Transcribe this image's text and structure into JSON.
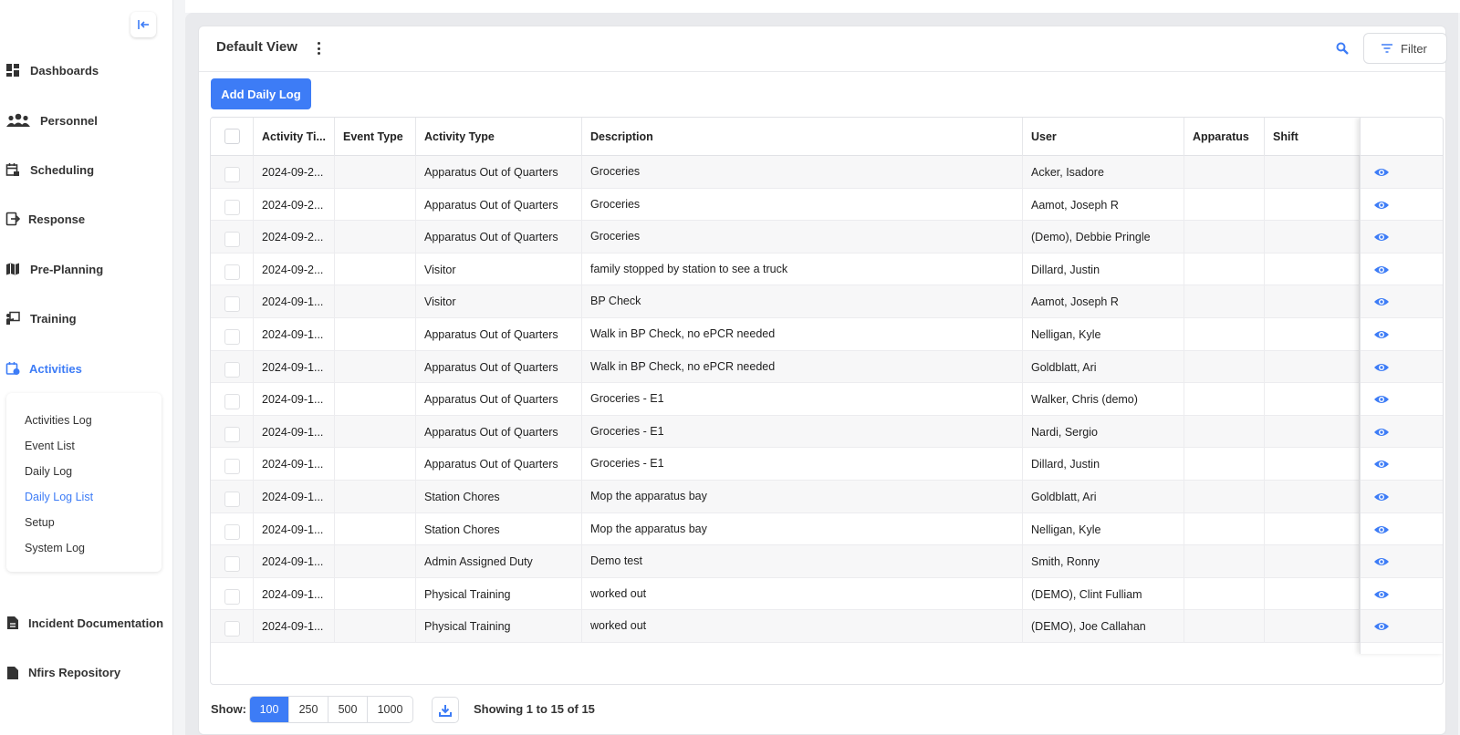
{
  "sidebar": {
    "nav": [
      {
        "label": "Dashboards",
        "icon": "grid-icon"
      },
      {
        "label": "Personnel",
        "icon": "people-icon"
      },
      {
        "label": "Scheduling",
        "icon": "calendar-icon"
      },
      {
        "label": "Response",
        "icon": "response-icon"
      },
      {
        "label": "Pre-Planning",
        "icon": "map-icon"
      },
      {
        "label": "Training",
        "icon": "training-icon"
      },
      {
        "label": "Activities",
        "icon": "activities-icon"
      },
      {
        "label": "Incident Documentation",
        "icon": "document-icon"
      },
      {
        "label": "Nfirs Repository",
        "icon": "document-icon"
      }
    ],
    "submenu": [
      "Activities Log",
      "Event List",
      "Daily Log",
      "Daily Log List",
      "Setup",
      "System Log"
    ],
    "active_nav": "Activities",
    "active_sub": "Daily Log List"
  },
  "header": {
    "title": "Default View",
    "filter_label": "Filter",
    "add_label": "Add Daily Log"
  },
  "table": {
    "columns": [
      "Activity Ti...",
      "Event Type",
      "Activity Type",
      "Description",
      "User",
      "Apparatus",
      "Shift"
    ],
    "rows": [
      {
        "time": "2024-09-2...",
        "event": "",
        "type": "Apparatus Out of Quarters",
        "desc": "Groceries",
        "user": "Acker, Isadore",
        "apparatus": "",
        "shift": ""
      },
      {
        "time": "2024-09-2...",
        "event": "",
        "type": "Apparatus Out of Quarters",
        "desc": "Groceries",
        "user": "Aamot, Joseph R",
        "apparatus": "",
        "shift": ""
      },
      {
        "time": "2024-09-2...",
        "event": "",
        "type": "Apparatus Out of Quarters",
        "desc": "Groceries",
        "user": "(Demo), Debbie Pringle",
        "apparatus": "",
        "shift": ""
      },
      {
        "time": "2024-09-2...",
        "event": "",
        "type": "Visitor",
        "desc": "family stopped by station to see a truck",
        "user": "Dillard, Justin",
        "apparatus": "",
        "shift": ""
      },
      {
        "time": "2024-09-1...",
        "event": "",
        "type": "Visitor",
        "desc": "BP Check",
        "user": "Aamot, Joseph R",
        "apparatus": "",
        "shift": ""
      },
      {
        "time": "2024-09-1...",
        "event": "",
        "type": "Apparatus Out of Quarters",
        "desc": "Walk in BP Check, no ePCR needed",
        "user": "Nelligan, Kyle",
        "apparatus": "",
        "shift": ""
      },
      {
        "time": "2024-09-1...",
        "event": "",
        "type": "Apparatus Out of Quarters",
        "desc": "Walk in BP Check, no ePCR needed",
        "user": "Goldblatt, Ari",
        "apparatus": "",
        "shift": ""
      },
      {
        "time": "2024-09-1...",
        "event": "",
        "type": "Apparatus Out of Quarters",
        "desc": "Groceries - E1",
        "user": "Walker, Chris (demo)",
        "apparatus": "",
        "shift": ""
      },
      {
        "time": "2024-09-1...",
        "event": "",
        "type": "Apparatus Out of Quarters",
        "desc": "Groceries - E1",
        "user": "Nardi, Sergio",
        "apparatus": "",
        "shift": ""
      },
      {
        "time": "2024-09-1...",
        "event": "",
        "type": "Apparatus Out of Quarters",
        "desc": "Groceries - E1",
        "user": "Dillard, Justin",
        "apparatus": "",
        "shift": ""
      },
      {
        "time": "2024-09-1...",
        "event": "",
        "type": "Station Chores",
        "desc": "Mop the apparatus bay",
        "user": "Goldblatt, Ari",
        "apparatus": "",
        "shift": ""
      },
      {
        "time": "2024-09-1...",
        "event": "",
        "type": "Station Chores",
        "desc": "Mop the apparatus bay",
        "user": "Nelligan, Kyle",
        "apparatus": "",
        "shift": ""
      },
      {
        "time": "2024-09-1...",
        "event": "",
        "type": "Admin Assigned Duty",
        "desc": "Demo test",
        "user": "Smith, Ronny",
        "apparatus": "",
        "shift": ""
      },
      {
        "time": "2024-09-1...",
        "event": "",
        "type": "Physical Training",
        "desc": "worked out",
        "user": "(DEMO), Clint Fulliam",
        "apparatus": "",
        "shift": ""
      },
      {
        "time": "2024-09-1...",
        "event": "",
        "type": "Physical Training",
        "desc": "worked out",
        "user": "(DEMO), Joe Callahan",
        "apparatus": "",
        "shift": ""
      }
    ]
  },
  "footer": {
    "show_label": "Show:",
    "page_sizes": [
      "100",
      "250",
      "500",
      "1000"
    ],
    "selected_page_size": "100",
    "showing_text": "Showing 1 to 15 of 15"
  },
  "colors": {
    "accent": "#3d7cf6",
    "text": "#222222",
    "row_alt": "#f7f7f8"
  }
}
